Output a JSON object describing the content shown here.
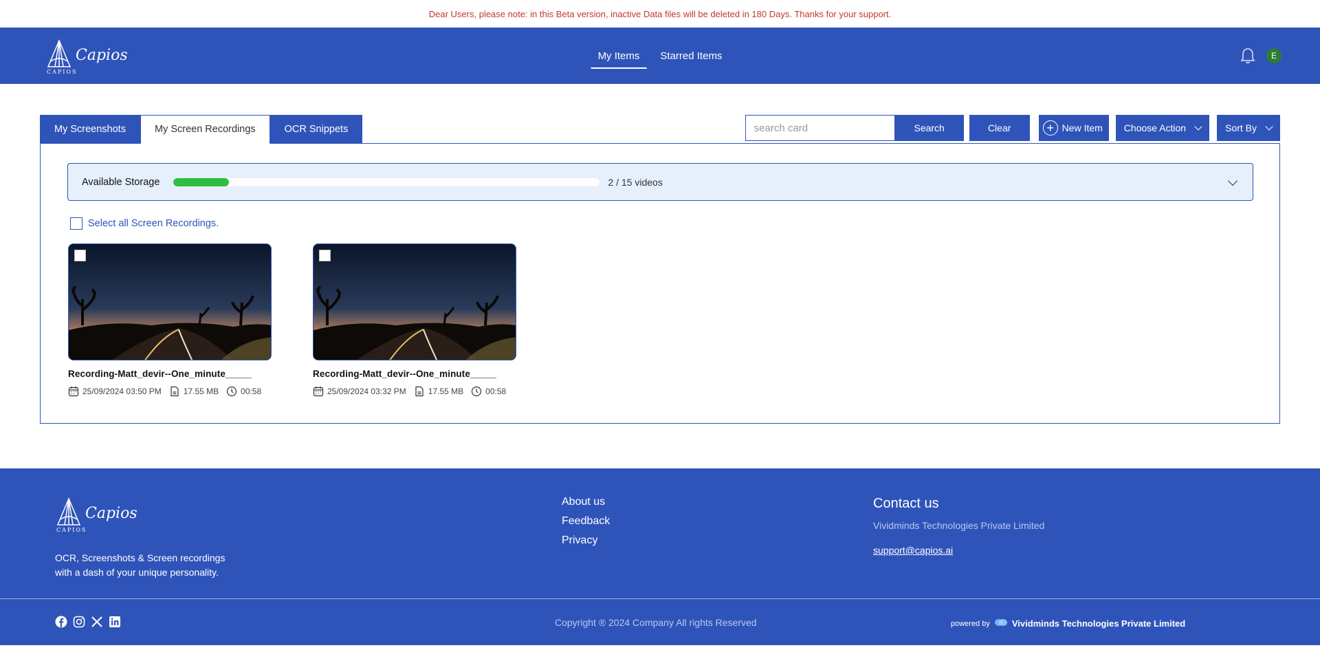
{
  "notice": "Dear Users, please note: in this Beta version, inactive Data files will be deleted in 180 Days. Thanks for your support.",
  "brand": {
    "name": "Capios",
    "sub": "CAPIOS"
  },
  "nav": {
    "my_items": "My Items",
    "starred_items": "Starred Items"
  },
  "user": {
    "initial": "E"
  },
  "tabs": [
    {
      "label": "My Screenshots"
    },
    {
      "label": "My Screen Recordings"
    },
    {
      "label": "OCR Snippets"
    }
  ],
  "search": {
    "placeholder": "search card",
    "value": ""
  },
  "buttons": {
    "search": "Search",
    "clear": "Clear",
    "new_item": "New Item",
    "choose_action": "Choose Action",
    "sort_by": "Sort By"
  },
  "storage": {
    "label": "Available Storage",
    "used": "2",
    "sep": "/",
    "total": "15",
    "unit": "videos",
    "fraction": 0.13
  },
  "select_all": "Select all Screen Recordings.",
  "recordings": [
    {
      "title": "Recording-Matt_devir--One_minute_____",
      "date": "25/09/2024 03:50 PM",
      "size": "17.55 MB",
      "duration": "00:58"
    },
    {
      "title": "Recording-Matt_devir--One_minute_____",
      "date": "25/09/2024 03:32 PM",
      "size": "17.55 MB",
      "duration": "00:58"
    }
  ],
  "footer": {
    "tagline_1": "OCR, Screenshots & Screen recordings",
    "tagline_2": "with a dash of your unique personality.",
    "links": [
      "About us",
      "Feedback",
      "Privacy"
    ],
    "contact_title": "Contact us",
    "company": "Vividminds Technologies Private Limited",
    "email": "support@capios.ai",
    "copyright": "Copyright ® 2024 Company All rights Reserved",
    "powered_by": "powered by",
    "powered_brand": "Vividminds Technologies Private Limited"
  },
  "colors": {
    "primary": "#2f54b9",
    "notice": "#c0392b",
    "progress": "#2ebd3f",
    "storage_bg": "#e6effc",
    "avatar": "#2e7d32"
  }
}
